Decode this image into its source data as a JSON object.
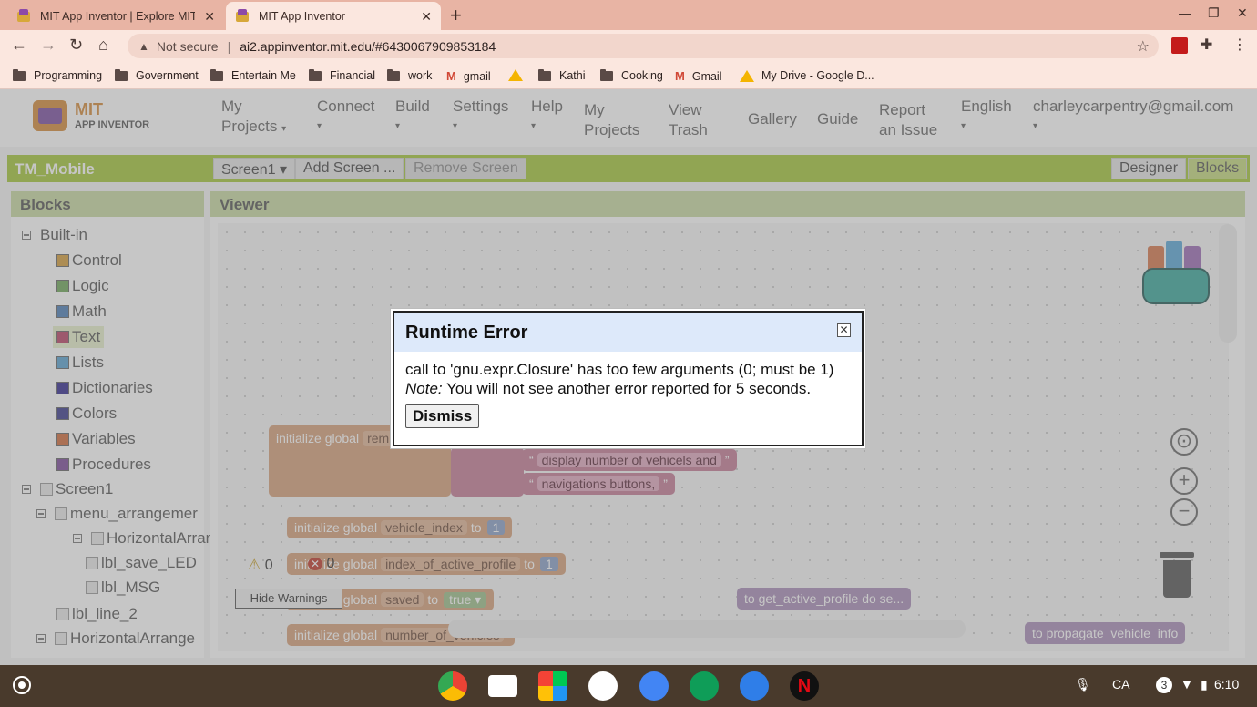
{
  "browser": {
    "tabs": [
      {
        "title": "MIT App Inventor | Explore MIT A",
        "active": false
      },
      {
        "title": "MIT App Inventor",
        "active": true
      }
    ],
    "new_tab": "+",
    "address": {
      "security": "Not secure",
      "separator": "|",
      "url": "ai2.appinventor.mit.edu/#6430067909853184"
    },
    "bookmarks": [
      "Programming",
      "Government",
      "Entertain Me",
      "Financial",
      "work",
      "gmail",
      "Kathi",
      "Cooking",
      "Gmail",
      "My Drive - Google D..."
    ]
  },
  "app": {
    "logo": {
      "line1": "MIT",
      "line2": "APP INVENTOR"
    },
    "menu": [
      {
        "l1": "My",
        "l2": "Projects",
        "caret": "▾"
      },
      {
        "l1": "Connect",
        "l2": "",
        "caret": "▾"
      },
      {
        "l1": "Build",
        "l2": "",
        "caret": "▾"
      },
      {
        "l1": "Settings",
        "l2": "",
        "caret": "▾"
      },
      {
        "l1": "Help",
        "l2": "",
        "caret": "▾"
      },
      {
        "l1": "My",
        "l2": "Projects",
        "caret": ""
      },
      {
        "l1": "View",
        "l2": "Trash",
        "caret": ""
      },
      {
        "l1": "Gallery",
        "l2": "",
        "caret": ""
      },
      {
        "l1": "Guide",
        "l2": "",
        "caret": ""
      },
      {
        "l1": "Report",
        "l2": "an Issue",
        "caret": ""
      },
      {
        "l1": "English",
        "l2": "",
        "caret": "▾"
      },
      {
        "l1": "charleycarpentry@gmail.com",
        "l2": "",
        "caret": "▾"
      }
    ],
    "project_name": "TM_Mobile",
    "screen_select": "Screen1 ▾",
    "add_screen": "Add Screen ...",
    "remove_screen": "Remove Screen",
    "designer": "Designer",
    "blocks": "Blocks",
    "blocks_panel": {
      "title": "Blocks",
      "builtin": "Built-in",
      "categories": [
        {
          "label": "Control",
          "color": "#d59e3c"
        },
        {
          "label": "Logic",
          "color": "#6fa85a"
        },
        {
          "label": "Math",
          "color": "#4c7fb7"
        },
        {
          "label": "Text",
          "color": "#b84466"
        },
        {
          "label": "Lists",
          "color": "#5ba2d1"
        },
        {
          "label": "Dictionaries",
          "color": "#332a90"
        },
        {
          "label": "Colors",
          "color": "#3b3b8c"
        },
        {
          "label": "Variables",
          "color": "#d06b3c"
        },
        {
          "label": "Procedures",
          "color": "#7d4a9a"
        }
      ],
      "screen": "Screen1",
      "components": [
        "menu_arrangemer",
        "HorizontalArran",
        "lbl_save_LED",
        "lbl_MSG",
        "lbl_line_2",
        "HorizontalArrange"
      ]
    },
    "viewer": {
      "title": "Viewer",
      "blocks": {
        "init_global": "initialize global",
        "rem": "rem",
        "text1": "display number of vehicels and",
        "text2": "navigations buttons,",
        "quote": "“",
        "quote_end": "”",
        "vehicle_index": "vehicle_index",
        "index_active": "index_of_active_profile",
        "saved": "saved",
        "to": "to",
        "one": "1",
        "true": "true ▾",
        "number_of": "number_of_vehicles",
        "get_active": "to get_active_profile do se...",
        "propagate": "to propagate_vehicle_info"
      },
      "warnings_count": "0",
      "errors_count": "0",
      "hide_warnings": "Hide Warnings"
    }
  },
  "dialog": {
    "title": "Runtime Error",
    "close": "✕",
    "message": "call to 'gnu.expr.Closure' has too few arguments (0; must be 1)",
    "note_label": "Note:",
    "note_text": "You will not see another error reported for 5 seconds.",
    "dismiss": "Dismiss"
  },
  "shelf": {
    "ime": "CA",
    "notifications": "3",
    "time": "6:10"
  }
}
